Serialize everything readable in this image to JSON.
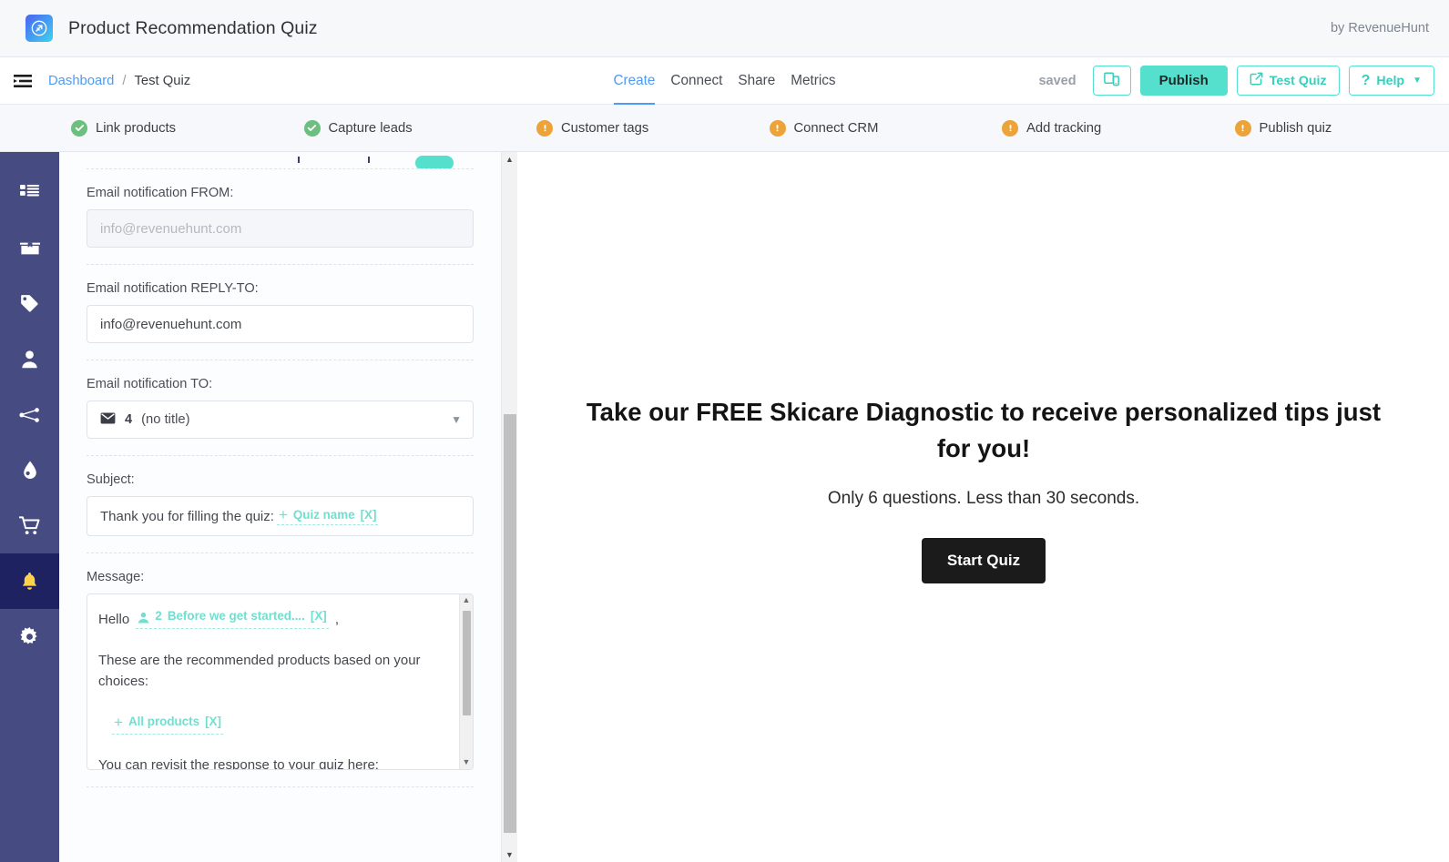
{
  "brand": {
    "logo_icon": "revenuehunt-logo-icon",
    "title": "Product Recommendation Quiz",
    "by": "by RevenueHunt"
  },
  "navbar": {
    "menu_icon": "indent-list-icon",
    "breadcrumb": {
      "root": "Dashboard",
      "separator": "/",
      "current": "Test Quiz"
    },
    "tabs": [
      {
        "label": "Create",
        "active": true
      },
      {
        "label": "Connect",
        "active": false
      },
      {
        "label": "Share",
        "active": false
      },
      {
        "label": "Metrics",
        "active": false
      }
    ],
    "status": "saved",
    "actions": {
      "preview_devices_icon": "devices-preview-icon",
      "publish": "Publish",
      "test_quiz": "Test Quiz",
      "test_quiz_icon": "external-link-icon",
      "help": "Help",
      "help_icon": "question-mark-icon",
      "help_chevron": "chevron-down-icon"
    }
  },
  "checklist": [
    {
      "label": "Link products",
      "state": "done",
      "icon": "check-circle-icon"
    },
    {
      "label": "Capture leads",
      "state": "done",
      "icon": "check-circle-icon"
    },
    {
      "label": "Customer tags",
      "state": "todo",
      "icon": "exclamation-circle-icon"
    },
    {
      "label": "Connect CRM",
      "state": "todo",
      "icon": "exclamation-circle-icon"
    },
    {
      "label": "Add tracking",
      "state": "todo",
      "icon": "exclamation-circle-icon"
    },
    {
      "label": "Publish quiz",
      "state": "todo",
      "icon": "exclamation-circle-icon"
    }
  ],
  "rail": [
    {
      "name": "sidebar-item-dashboard",
      "icon": "list-grid-icon",
      "active": false
    },
    {
      "name": "sidebar-item-products",
      "icon": "box-icon",
      "active": false
    },
    {
      "name": "sidebar-item-tags",
      "icon": "tag-icon",
      "active": false
    },
    {
      "name": "sidebar-item-leads",
      "icon": "person-icon",
      "active": false
    },
    {
      "name": "sidebar-item-logic",
      "icon": "branch-icon",
      "active": false
    },
    {
      "name": "sidebar-item-design",
      "icon": "droplet-icon",
      "active": false
    },
    {
      "name": "sidebar-item-cart",
      "icon": "cart-icon",
      "active": false
    },
    {
      "name": "sidebar-item-notifications",
      "icon": "bell-icon",
      "active": true
    },
    {
      "name": "sidebar-item-settings",
      "icon": "gear-icon",
      "active": false
    }
  ],
  "form": {
    "from": {
      "label": "Email notification FROM:",
      "value": "",
      "placeholder": "info@revenuehunt.com"
    },
    "reply_to": {
      "label": "Email notification REPLY-TO:",
      "value": "info@revenuehunt.com",
      "placeholder": "info@revenuehunt.com"
    },
    "to": {
      "label": "Email notification TO:",
      "icon": "envelope-icon",
      "count": "4",
      "title": "(no title)",
      "chevron": "chevron-down-icon"
    },
    "subject": {
      "label": "Subject:",
      "text": "Thank you for filling the quiz:",
      "token_plus": "+",
      "token_label": "Quiz name",
      "token_remove": "[X]"
    },
    "message": {
      "label": "Message:",
      "greeting_prefix": "Hello",
      "greeting_token_icon": "person-token-icon",
      "greeting_token_count": "2",
      "greeting_token_label": "Before we get started....",
      "greeting_token_remove": "[X]",
      "greeting_suffix": ",",
      "line_products": "These are the recommended products based on your choices:",
      "products_token_plus": "+",
      "products_token_label": "All products",
      "products_token_remove": "[X]",
      "line_revisit": "You can revisit the response to your quiz here:"
    }
  },
  "preview": {
    "headline": "Take our FREE Skicare Diagnostic to receive personalized tips just for you!",
    "subtext": "Only 6 questions. Less than 30 seconds.",
    "start_button": "Start Quiz"
  },
  "colors": {
    "teal": "#55dfcd",
    "blue_link": "#4d9bf5",
    "sidebar": "#464b82",
    "sidebar_active": "#1f2260",
    "check_green": "#6cbf7e",
    "check_orange": "#eca33a",
    "cta_dark": "#1b1b1b"
  }
}
